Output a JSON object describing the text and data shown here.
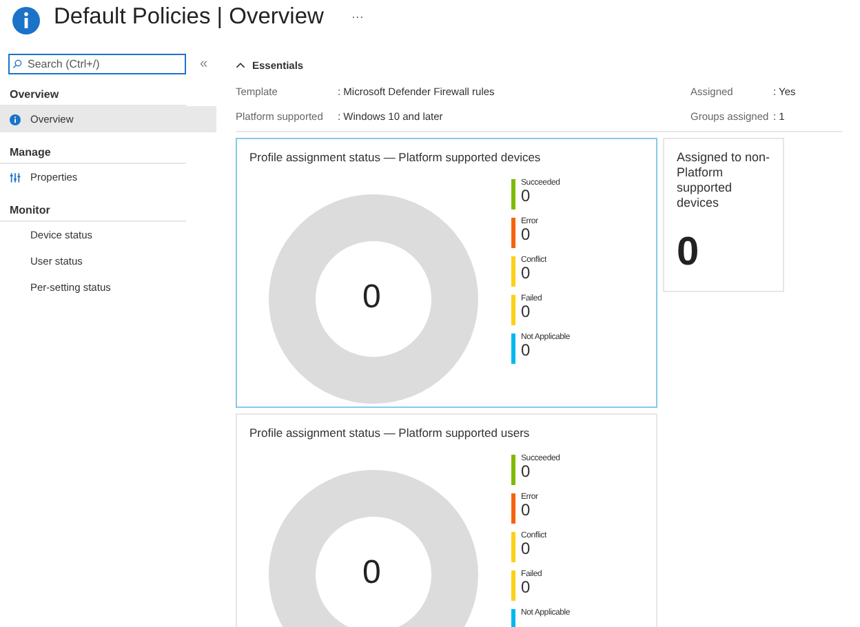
{
  "header": {
    "title": "Default Policies",
    "separator": "|",
    "subtitle": "Overview",
    "more": "···"
  },
  "sidebar": {
    "search": {
      "placeholder": "Search (Ctrl+/)"
    },
    "collapse": "«",
    "sections": [
      {
        "title": "Overview",
        "items": [
          {
            "label": "Overview",
            "kind": "info",
            "selected": true
          }
        ]
      },
      {
        "title": "Manage",
        "items": [
          {
            "label": "Properties",
            "kind": "sliders",
            "selected": false
          }
        ]
      },
      {
        "title": "Monitor",
        "items": [
          {
            "label": "Device status",
            "kind": "plain",
            "selected": false
          },
          {
            "label": "User status",
            "kind": "plain",
            "selected": false
          },
          {
            "label": "Per-setting status",
            "kind": "plain",
            "selected": false
          }
        ]
      }
    ]
  },
  "essentials": {
    "title": "Essentials",
    "expanded": true,
    "left": [
      {
        "label": "Template",
        "value": ": Microsoft Defender Firewall rules"
      },
      {
        "label": "Platform supported",
        "value": ": Windows 10 and later"
      }
    ],
    "right": [
      {
        "label": "Assigned",
        "value": ": Yes"
      },
      {
        "label": "Groups assigned",
        "value": ": 1"
      }
    ]
  },
  "cards": [
    {
      "title": "Profile assignment status — Platform supported devices",
      "total": "0",
      "selected": true,
      "legend": [
        {
          "label": "Succeeded",
          "value": "0",
          "color": "#7fba00"
        },
        {
          "label": "Error",
          "value": "0",
          "color": "#f7630c"
        },
        {
          "label": "Conflict",
          "value": "0",
          "color": "#fcd116"
        },
        {
          "label": "Failed",
          "value": "0",
          "color": "#fcd116"
        },
        {
          "label": "Not Applicable",
          "value": "0",
          "color": "#00b7f0"
        }
      ]
    },
    {
      "title": "Profile assignment status — Platform supported users",
      "total": "0",
      "selected": false,
      "legend": [
        {
          "label": "Succeeded",
          "value": "0",
          "color": "#7fba00"
        },
        {
          "label": "Error",
          "value": "0",
          "color": "#f7630c"
        },
        {
          "label": "Conflict",
          "value": "0",
          "color": "#fcd116"
        },
        {
          "label": "Failed",
          "value": "0",
          "color": "#fcd116"
        },
        {
          "label": "Not Applicable",
          "color": "#00b7f0"
        }
      ]
    }
  ],
  "side_card": {
    "title": "Assigned to non-Platform supported devices",
    "value": "0"
  }
}
